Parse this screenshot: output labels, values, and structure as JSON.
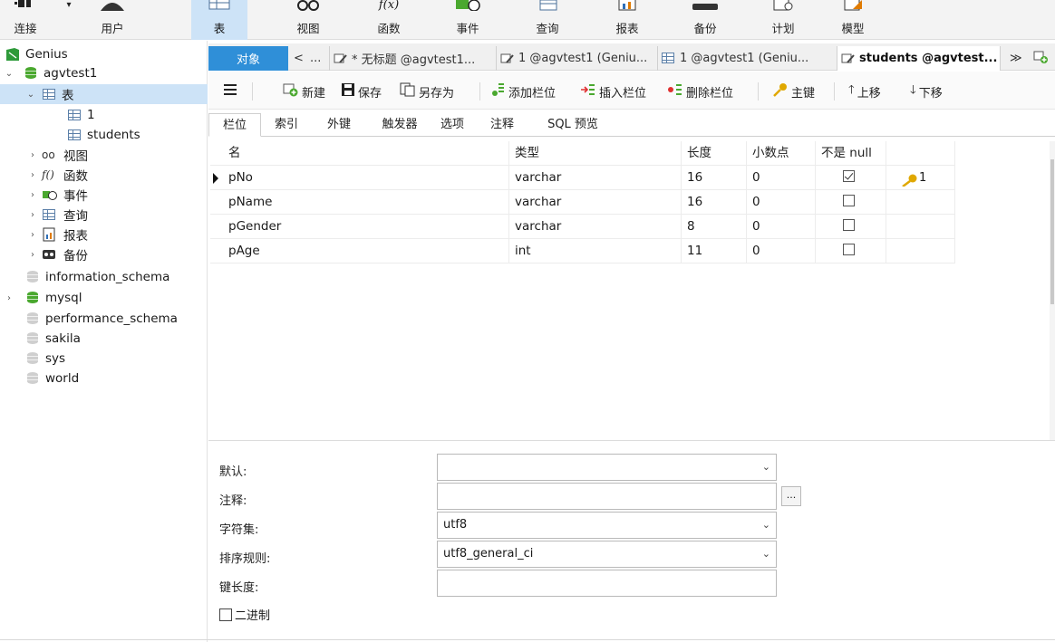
{
  "ribbon": {
    "items": [
      {
        "label": "连接",
        "icon": "connection-icon",
        "active": false
      },
      {
        "label": "用户",
        "icon": "user-icon",
        "active": false
      },
      {
        "label": "表",
        "icon": "table-icon",
        "active": true
      },
      {
        "label": "视图",
        "icon": "view-icon",
        "active": false
      },
      {
        "label": "函数",
        "icon": "function-icon",
        "active": false
      },
      {
        "label": "事件",
        "icon": "event-icon",
        "active": false
      },
      {
        "label": "查询",
        "icon": "query-icon",
        "active": false
      },
      {
        "label": "报表",
        "icon": "report-icon",
        "active": false
      },
      {
        "label": "备份",
        "icon": "backup-icon",
        "active": false
      },
      {
        "label": "计划",
        "icon": "schedule-icon",
        "active": false
      },
      {
        "label": "模型",
        "icon": "model-icon",
        "active": false
      }
    ]
  },
  "sidebar": {
    "connection": "Genius",
    "database": "agvtest1",
    "tables_node": "表",
    "tables": [
      "1",
      "students"
    ],
    "object_groups": [
      "视图",
      "函数",
      "事件",
      "查询",
      "报表",
      "备份"
    ],
    "other_databases": [
      "information_schema",
      "mysql",
      "performance_schema",
      "sakila",
      "sys",
      "world"
    ]
  },
  "doc_tabs": {
    "objects_label": "对象",
    "scroll_left": "<",
    "overflow": "...",
    "tabs": [
      "* 无标题 @agvtest1...",
      "1 @agvtest1 (Geniu...",
      "1 @agvtest1 (Geniu...",
      "students @agvtest..."
    ],
    "scroll_right": "≫"
  },
  "toolbar": {
    "new_label": "新建",
    "save_label": "保存",
    "save_as_label": "另存为",
    "add_field_label": "添加栏位",
    "insert_field_label": "插入栏位",
    "delete_field_label": "删除栏位",
    "primary_key_label": "主键",
    "move_up_label": "上移",
    "move_down_label": "下移"
  },
  "sub_tabs": [
    "栏位",
    "索引",
    "外键",
    "触发器",
    "选项",
    "注释",
    "SQL 预览"
  ],
  "grid": {
    "headers": {
      "name": "名",
      "type": "类型",
      "length": "长度",
      "decimals": "小数点",
      "not_null": "不是 null"
    },
    "rows": [
      {
        "name": "pNo",
        "type": "varchar",
        "length": "16",
        "decimals": "0",
        "not_null": true,
        "key": "1"
      },
      {
        "name": "pName",
        "type": "varchar",
        "length": "16",
        "decimals": "0",
        "not_null": false,
        "key": ""
      },
      {
        "name": "pGender",
        "type": "varchar",
        "length": "8",
        "decimals": "0",
        "not_null": false,
        "key": ""
      },
      {
        "name": "pAge",
        "type": "int",
        "length": "11",
        "decimals": "0",
        "not_null": false,
        "key": ""
      }
    ]
  },
  "properties": {
    "default_label": "默认:",
    "default_value": "",
    "comment_label": "注释:",
    "comment_value": "",
    "ellipsis": "...",
    "charset_label": "字符集:",
    "charset_value": "utf8",
    "collation_label": "排序规则:",
    "collation_value": "utf8_general_ci",
    "key_length_label": "键长度:",
    "key_length_value": "",
    "binary_label": "二进制"
  },
  "colors": {
    "accent": "#2f8fd8",
    "selection": "#cde3f7",
    "db_active": "#4aa82f",
    "key": "#e0a800"
  }
}
